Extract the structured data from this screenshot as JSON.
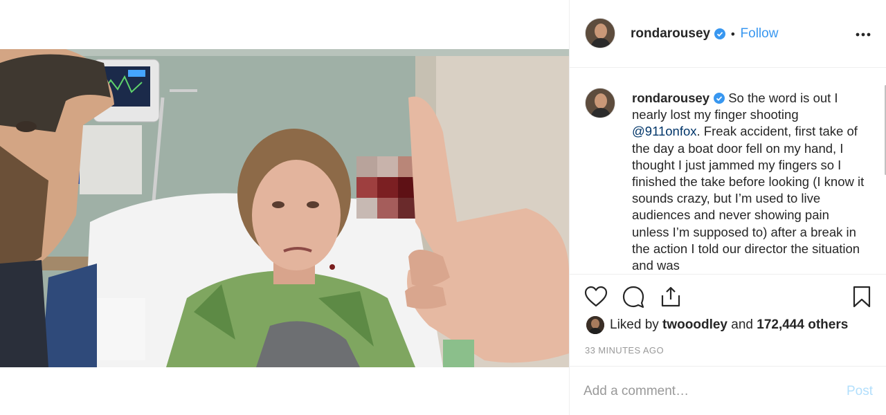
{
  "post": {
    "username": "rondarousey",
    "follow_label": "Follow",
    "separator": "•",
    "verified": true
  },
  "caption": {
    "username": "rondarousey",
    "text_before_mention": "So the word is out I nearly lost my finger shooting ",
    "mention": "@911onfox",
    "text_after_mention": ". Freak accident, first take of the day a boat door fell on my hand, I thought I just jammed my fingers so I finished the take before looking (I know it sounds crazy, but I’m used to live audiences and never showing pain unless I’m supposed to) after a break in the action I told our director the situation and was"
  },
  "likes": {
    "prefix": "Liked by ",
    "user": "twooodley",
    "middle": " and ",
    "count": "172,444 others"
  },
  "timestamp": "33 minutes ago",
  "comment": {
    "placeholder": "Add a comment…",
    "post_label": "Post"
  },
  "icons": {
    "like": "heart-icon",
    "comment": "comment-bubble-icon",
    "share": "share-icon",
    "save": "bookmark-icon",
    "more": "more-options-icon",
    "verified": "verified-badge-icon",
    "tag": "user-tag-icon"
  },
  "colors": {
    "link": "#3897f0",
    "mention": "#003569",
    "muted": "#999999",
    "post_disabled": "#b2dffc",
    "text": "#262626",
    "border": "#efefef"
  }
}
